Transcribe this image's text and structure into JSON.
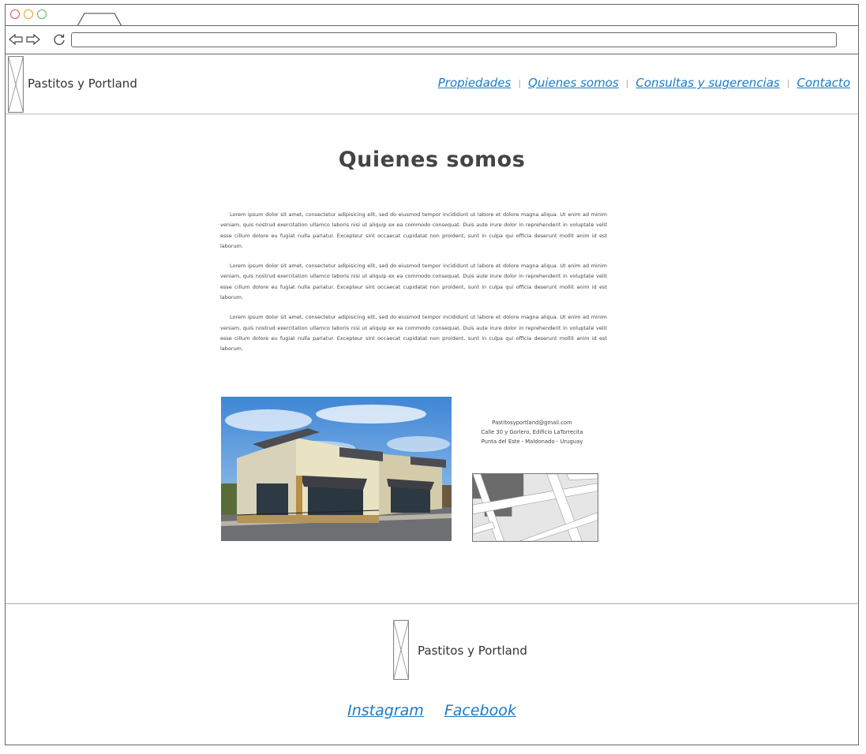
{
  "browser": {
    "url": ""
  },
  "header": {
    "brand": "Pastitos y Portland",
    "nav": [
      {
        "label": "Propiedades"
      },
      {
        "label": "Quienes somos"
      },
      {
        "label": "Consultas y sugerencias"
      },
      {
        "label": "Contacto"
      }
    ],
    "separator": "|"
  },
  "main": {
    "title": "Quienes somos",
    "paragraphs": [
      "Lorem ipsum dolor sit amet, consectetur adipisicing elit, sed do eiusmod tempor incididunt ut labore et dolore magna aliqua. Ut enim ad minim veniam, quis nostrud exercitation ullamco laboris nisi ut aliquip ex ea commodo consequat. Duis aute irure dolor in reprehenderit in voluptate velit esse cillum dolore eu fugiat nulla pariatur. Excepteur sint occaecat cupidatat non proident, sunt in culpa qui officia deserunt mollit anim id est laborum.",
      "Lorem ipsum dolor sit amet, consectetur adipisicing elit, sed do eiusmod tempor incididunt ut labore et dolore magna aliqua. Ut enim ad minim veniam, quis nostrud exercitation ullamco laboris nisi ut aliquip ex ea commodo consequat. Duis aute irure dolor in reprehenderit in voluptate velit esse cillum dolore eu fugiat nulla pariatur. Excepteur sint occaecat cupidatat non proident, sunt in culpa qui officia deserunt mollit anim id est laborum.",
      "Lorem ipsum dolor sit amet, consectetur adipisicing elit, sed do eiusmod tempor incididunt ut labore et dolore magna aliqua. Ut enim ad minim veniam, quis nostrud exercitation ullamco laboris nisi ut aliquip ex ea commodo consequat. Duis aute irure dolor in reprehenderit in voluptate velit esse cillum dolore eu fugiat nulla pariatur. Excepteur sint occaecat cupidatat non proident, sunt in culpa qui officia deserunt mollit anim id est laborum."
    ],
    "contact": {
      "email": "Pastitosyportland@gmail.com",
      "address": "Calle 30 y Gorlero, Edificio LaTorrecita",
      "city": "Punta del Este - Maldonado - Uruguay"
    }
  },
  "footer": {
    "brand": "Pastitos y Portland",
    "social": [
      {
        "label": "Instagram"
      },
      {
        "label": "Facebook"
      }
    ]
  },
  "colors": {
    "link": "#1a7bc7",
    "border": "#666666",
    "close_dot": "#d9534f",
    "minimize_dot": "#e6a817",
    "maximize_dot": "#5cb85c"
  },
  "icons": {
    "back": "back-arrow-icon",
    "forward": "forward-arrow-icon",
    "reload": "reload-icon",
    "logo": "image-placeholder-icon",
    "map": "map-placeholder-icon"
  }
}
